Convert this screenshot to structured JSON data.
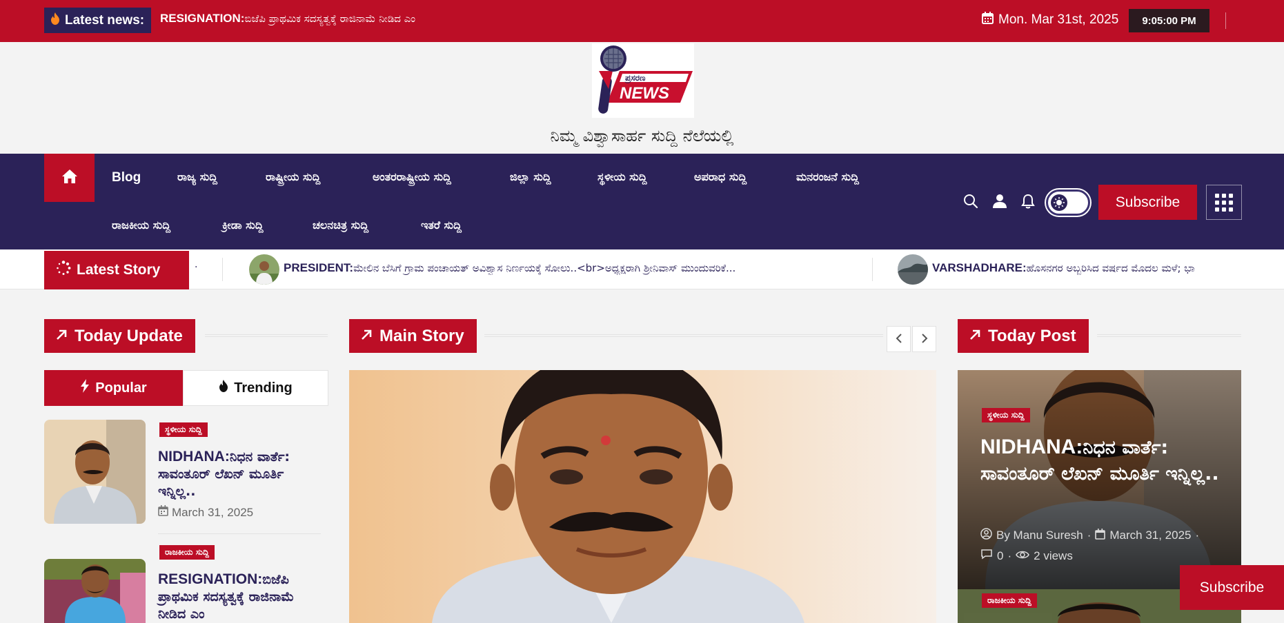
{
  "topbar": {
    "news_label": "Latest news:",
    "news_prefix": "RESIGNATION:",
    "news_text": "ಬಿಜೆಪಿ ಪ್ರಾಥಮಿಕ ಸದಸ್ಯತ್ವಕ್ಕೆ ರಾಜಿನಾಮೆ ನೀಡಿದ ಎಂ",
    "date": "Mon. Mar 31st, 2025",
    "time": "9:05:00 PM"
  },
  "branding": {
    "logo_small": "ಪ್ರಸರಣ",
    "logo_big": "NEWS",
    "tagline": "ನಿಮ್ಮ ವಿಶ್ವಾಸಾರ್ಹ ಸುದ್ದಿ ನೆಲೆಯಲ್ಲಿ"
  },
  "nav": {
    "items_row1": [
      "Blog",
      "ರಾಜ್ಯ ಸುದ್ದಿ",
      "ರಾಷ್ಟ್ರೀಯ ಸುದ್ದಿ",
      "ಅಂತರರಾಷ್ಟ್ರೀಯ ಸುದ್ದಿ",
      "ಜಿಲ್ಲಾ ಸುದ್ದಿ",
      "ಸ್ಥಳೀಯ ಸುದ್ದಿ",
      "ಅಪರಾಧ ಸುದ್ದಿ",
      "ಮನರಂಜನೆ ಸುದ್ದಿ"
    ],
    "items_row2": [
      "ರಾಜಕೀಯ ಸುದ್ದಿ",
      "ಕ್ರೀಡಾ ಸುದ್ದಿ",
      "ಚಲನಚಿತ್ರ ಸುದ್ದಿ",
      "ಇತರೆ ಸುದ್ದಿ"
    ],
    "subscribe": "Subscribe"
  },
  "latest_story": {
    "label": "Latest Story",
    "dot": "·",
    "items": [
      {
        "prefix": "PRESIDENT:",
        "text": "ಮೇಲಿನ ಬೆಸಿಗೆ ಗ್ರಾಮ ಪಂಚಾಯತ್ ಅವಿಶ್ವಾಸ ನಿರ್ಣಯಕ್ಕೆ ಸೋಲು..<br>ಅಧ್ಯಕ್ಷರಾಗಿ ಶ್ರೀನಿವಾಸ್ ಮುಂದುವರಿಕೆ..."
      },
      {
        "prefix": "VARSHADHARE:",
        "text": "ಹೊಸನಗರ ಅಬ್ಬರಿಸಿದ ವರ್ಷದ ಮೊದಲ ಮಳೆ; ಭಾ"
      }
    ]
  },
  "sections": {
    "today_update": "Today Update",
    "main_story": "Main Story",
    "today_post": "Today Post"
  },
  "tabs": {
    "popular": "Popular",
    "trending": "Trending"
  },
  "popular_posts": [
    {
      "category": "ಸ್ಥಳೀಯ ಸುದ್ದಿ",
      "prefix": "NIDHANA:",
      "title": "ನಿಧನ ವಾರ್ತೆ: ಸಾವಂತೂರ್ ಲೆಖನ್ ಮೂರ್ತಿ ಇನ್ನಿಲ್ಲ..",
      "date": "March 31, 2025"
    },
    {
      "category": "ರಾಜಕೀಯ ಸುದ್ದಿ",
      "prefix": "RESIGNATION:",
      "title": "ಬಿಜೆಪಿ ಪ್ರಾಥಮಿಕ ಸದಸ್ಯತ್ವಕ್ಕೆ ರಾಜಿನಾಮೆ ನೀಡಿದ ಎಂ"
    }
  ],
  "today_post": {
    "category": "ಸ್ಥಳೀಯ ಸುದ್ದಿ",
    "prefix": "NIDHANA:",
    "title": "ನಿಧನ ವಾರ್ತೆ: ಸಾವಂತೂರ್ ಲೆಖನ್ ಮೂರ್ತಿ ಇನ್ನಿಲ್ಲ..",
    "author": "By Manu Suresh",
    "date": "March 31, 2025",
    "comments": "0",
    "views": "2 views",
    "next_category": "ರಾಜಕೀಯ ಸುದ್ದಿ"
  },
  "float_subscribe": "Subscribe",
  "colors": {
    "brand_red": "#bc0e26",
    "nav_navy": "#2b2258"
  }
}
